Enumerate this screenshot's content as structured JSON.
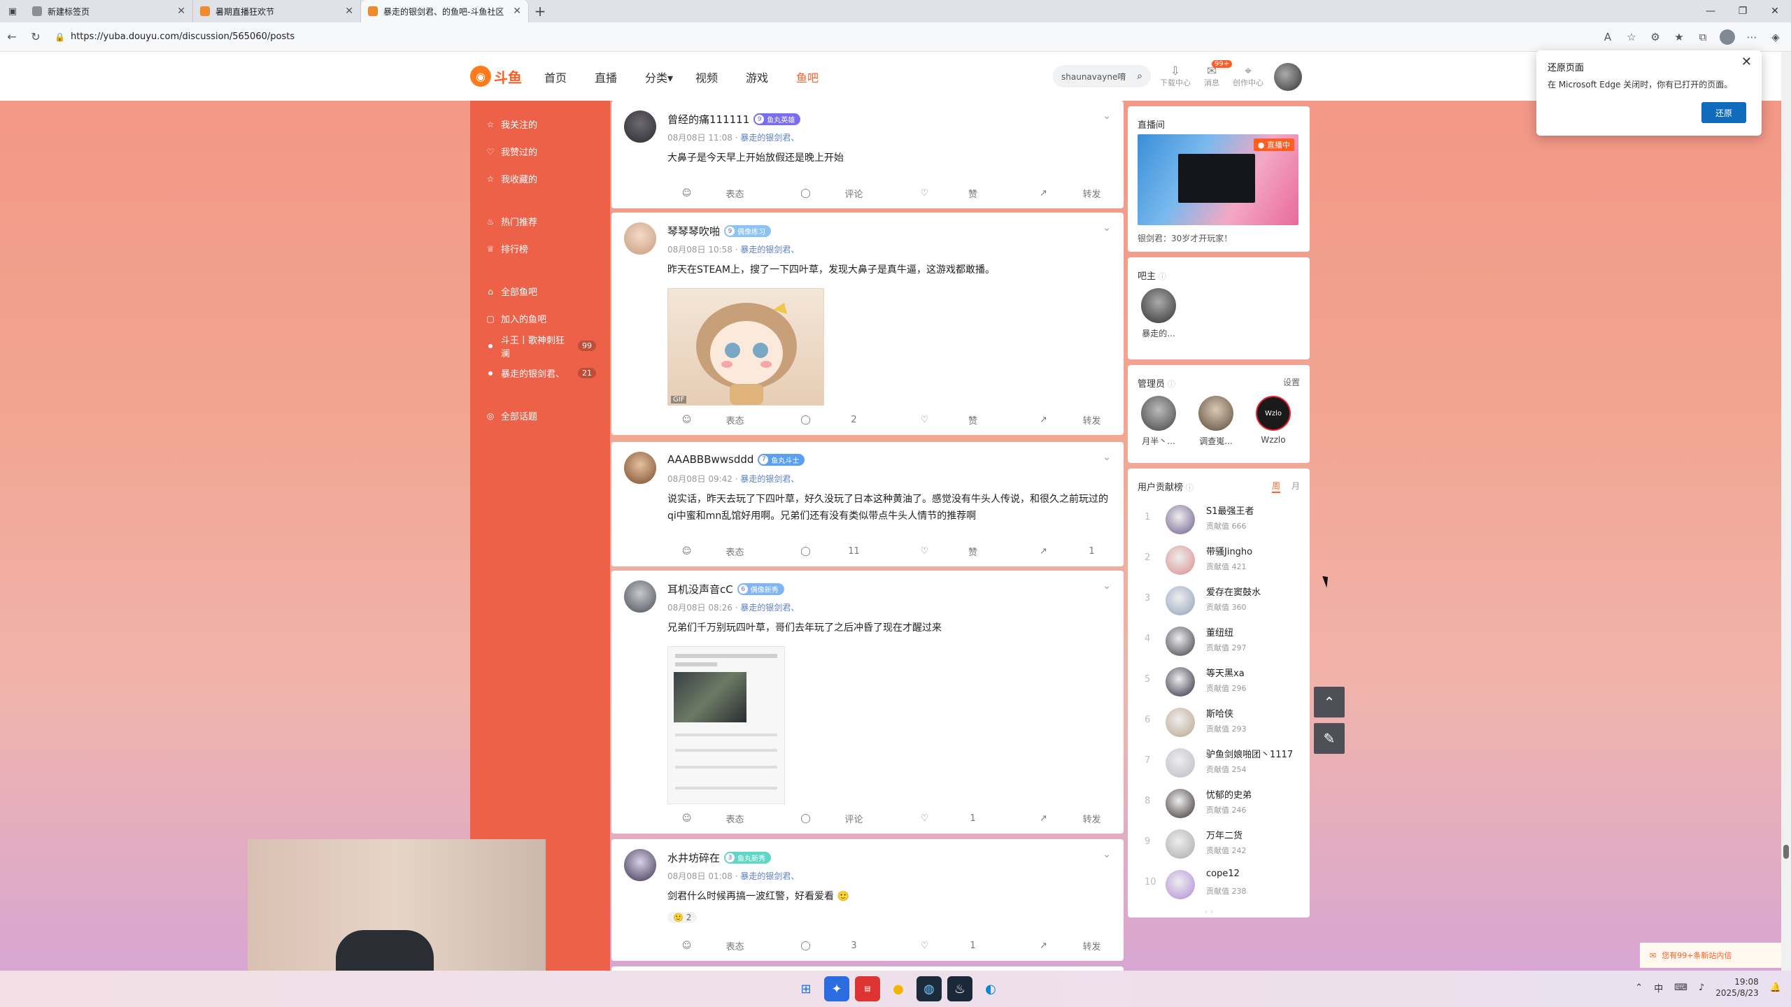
{
  "browser": {
    "tabs": [
      {
        "label": "新建标签页",
        "active": false
      },
      {
        "label": "暑期直播狂欢节",
        "active": false
      },
      {
        "label": "暴走的银剑君、的鱼吧-斗鱼社区",
        "active": true
      }
    ],
    "url": "https://yuba.douyu.com/discussion/565060/posts"
  },
  "header": {
    "logo": "斗鱼",
    "nav": [
      "首页",
      "直播",
      "分类",
      "视频",
      "游戏",
      "鱼吧"
    ],
    "active_nav": "鱼吧",
    "search_value": "shaunavayne唷",
    "icons": [
      {
        "label": "下载中心",
        "icon": "download-icon"
      },
      {
        "label": "消息",
        "icon": "message-icon",
        "badge": "99+"
      },
      {
        "label": "创作中心",
        "icon": "location-icon"
      }
    ]
  },
  "sidebar": {
    "group1": [
      {
        "label": "我关注的",
        "icon": "star-icon"
      },
      {
        "label": "我赞过的",
        "icon": "like-icon"
      },
      {
        "label": "我收藏的",
        "icon": "bookmark-icon"
      }
    ],
    "group2": [
      {
        "label": "热门推荐",
        "icon": "fire-icon"
      },
      {
        "label": "排行榜",
        "icon": "trophy-icon"
      }
    ],
    "group3": [
      {
        "label": "全部鱼吧",
        "icon": "home-icon"
      },
      {
        "label": "加入的鱼吧",
        "icon": "joined-icon"
      }
    ],
    "bars": [
      {
        "label": "斗王丨歌神刺狂澜",
        "count": "99"
      },
      {
        "label": "暴走的银剑君、",
        "count": "21"
      }
    ],
    "group4": [
      {
        "label": "全部话题",
        "icon": "topic-icon"
      }
    ]
  },
  "posts": [
    {
      "user": "曾经的痛111111",
      "level": "9",
      "level_title": "鱼丸英雄",
      "time": "08月08日 11:08",
      "group": "暴走的银剑君、",
      "text": "大鼻子是今天早上开始放假还是晚上开始",
      "actions": [
        "表态",
        "评论",
        "赞",
        "转发"
      ]
    },
    {
      "user": "琴琴琴吹啪",
      "level": "9",
      "level_title": "偶像练习",
      "time": "08月08日 10:58",
      "group": "暴走的银剑君、",
      "text": "昨天在STEAM上，搜了一下四叶草，发现大鼻子是真牛逼，这游戏都敢播。",
      "image_tag": "GIF",
      "actions": [
        "表态",
        "2",
        "赞",
        "转发"
      ]
    },
    {
      "user": "AAABBBwwsddd",
      "level": "7",
      "level_title": "鱼丸斗士",
      "time": "08月08日 09:42",
      "group": "暴走的银剑君、",
      "text": "说实话，昨天去玩了下四叶草，好久没玩了日本这种黄油了。感觉没有牛头人传说，和很久之前玩过的qi中蜜和mn乱馆好用啊。兄弟们还有没有类似带点牛头人情节的推荐啊",
      "actions": [
        "表态",
        "11",
        "赞",
        "1"
      ]
    },
    {
      "user": "耳机没声音cC",
      "level": "6",
      "level_title": "偶像新秀",
      "time": "08月08日 08:26",
      "group": "暴走的银剑君、",
      "text": "兄弟们千万别玩四叶草，哥们去年玩了之后冲昏了现在才醒过来",
      "actions": [
        "表态",
        "评论",
        "1",
        "转发"
      ]
    },
    {
      "user": "水井坊碎在",
      "level": "3",
      "level_title": "鱼丸新秀",
      "time": "08月08日 01:08",
      "group": "暴走的银剑君、",
      "text": "剑君什么时候再搞一波红警，好看爱看",
      "reaction_count": "2",
      "actions": [
        "表态",
        "3",
        "1",
        "转发"
      ]
    }
  ],
  "right": {
    "live_title": "直播间",
    "live_tag": "直播中",
    "live_caption": "银剑君：30岁才开玩家！",
    "owner_title": "吧主",
    "owner_name": "暴走的...",
    "admins_title": "管理员",
    "admins_setting": "设置",
    "admins": [
      "月半丶...",
      "调查嵬...",
      "Wzzlo"
    ],
    "avatar_text": "Wzlo",
    "rank_title": "用户贡献榜",
    "rank_tabs": [
      "周",
      "月"
    ],
    "rank_prefix": "贡献值",
    "rank": [
      {
        "n": "1",
        "name": "S1最强王者",
        "v": "666"
      },
      {
        "n": "2",
        "name": "带骚Jingho",
        "v": "421"
      },
      {
        "n": "3",
        "name": "爱存在窦鼓水",
        "v": "360"
      },
      {
        "n": "4",
        "name": "董纽纽",
        "v": "297"
      },
      {
        "n": "5",
        "name": "等天黑xa",
        "v": "296"
      },
      {
        "n": "6",
        "name": "斯哈侠",
        "v": "293"
      },
      {
        "n": "7",
        "name": "驴鱼剑娘啪团丶1117",
        "v": "254"
      },
      {
        "n": "8",
        "name": "忧郁的史弟",
        "v": "246"
      },
      {
        "n": "9",
        "name": "万年二货",
        "v": "242"
      },
      {
        "n": "10",
        "name": "cope12",
        "v": "238"
      }
    ]
  },
  "popup": {
    "title": "还原页面",
    "body": "在 Microsoft Edge 关闭时，你有已打开的页面。",
    "button": "还原"
  },
  "toast": "您有99+条新站内信",
  "clock": {
    "time": "19:08",
    "date": "2025/8/23"
  },
  "tray": {
    "ime": "中"
  }
}
